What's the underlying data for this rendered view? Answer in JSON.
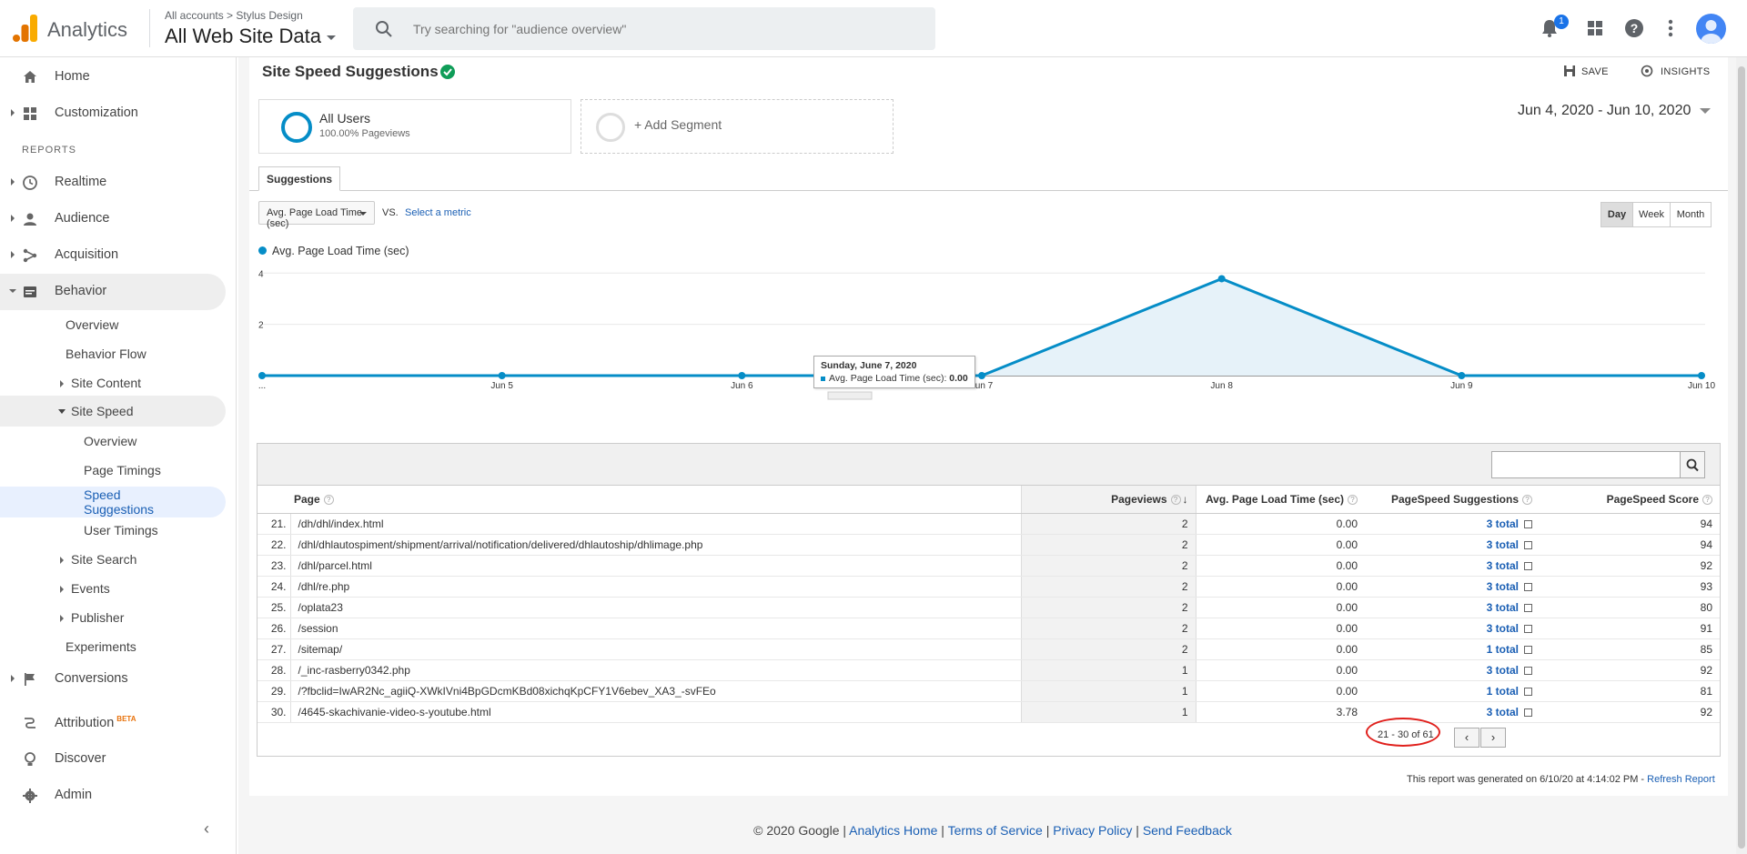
{
  "header": {
    "app_name": "Analytics",
    "breadcrumb": "All accounts > Stylus Design",
    "property": "All Web Site Data",
    "search_placeholder": "Try searching for \"audience overview\"",
    "notifications_count": "1"
  },
  "sidebar": {
    "home": "Home",
    "customization": "Customization",
    "reports_label": "REPORTS",
    "realtime": "Realtime",
    "audience": "Audience",
    "acquisition": "Acquisition",
    "behavior": "Behavior",
    "behavior_sub": {
      "overview": "Overview",
      "behavior_flow": "Behavior Flow",
      "site_content": "Site Content",
      "site_speed": "Site Speed",
      "site_speed_sub": {
        "overview": "Overview",
        "page_timings": "Page Timings",
        "speed_suggestions_1": "Speed",
        "speed_suggestions_2": "Suggestions",
        "user_timings": "User Timings"
      },
      "site_search": "Site Search",
      "events": "Events",
      "publisher": "Publisher",
      "experiments": "Experiments"
    },
    "conversions": "Conversions",
    "attribution": "Attribution",
    "attribution_badge": "BETA",
    "discover": "Discover",
    "admin": "Admin"
  },
  "report": {
    "title": "Site Speed Suggestions",
    "save_label": "SAVE",
    "insights_label": "INSIGHTS",
    "segment_name": "All Users",
    "segment_sub": "100.00% Pageviews",
    "add_segment": "+ Add Segment",
    "date_range": "Jun 4, 2020 - Jun 10, 2020",
    "tab": "Suggestions",
    "metric": "Avg. Page Load Time (sec)",
    "vs": "VS.",
    "select_metric": "Select a metric",
    "periods": [
      "Day",
      "Week",
      "Month"
    ],
    "tooltip_date": "Sunday, June 7, 2020",
    "tooltip_metric": "Avg. Page Load Time (sec):",
    "tooltip_value": "0.00"
  },
  "chart_data": {
    "type": "area",
    "series": [
      {
        "name": "Avg. Page Load Time (sec)",
        "values": [
          0,
          0,
          0,
          0,
          3.78,
          0,
          0
        ]
      }
    ],
    "x": [
      "...",
      "Jun 5",
      "Jun 6",
      "Jun 7",
      "Jun 8",
      "Jun 9",
      "Jun 10"
    ],
    "yticks": [
      "4",
      "2"
    ],
    "ylim": [
      0,
      4.4
    ],
    "color": "#058dc7"
  },
  "table": {
    "headers": {
      "page": "Page",
      "pageviews": "Pageviews",
      "load": "Avg. Page Load Time (sec)",
      "suggestions": "PageSpeed Suggestions",
      "score": "PageSpeed Score"
    },
    "rows": [
      {
        "n": "21.",
        "page": "/dh/dhl/index.html",
        "pv": "2",
        "load": "0.00",
        "sugg": "3 total",
        "score": "94"
      },
      {
        "n": "22.",
        "page": "/dhl/dhlautospiment/shipment/arrival/notification/delivered/dhlautoship/dhlimage.php",
        "pv": "2",
        "load": "0.00",
        "sugg": "3 total",
        "score": "94"
      },
      {
        "n": "23.",
        "page": "/dhl/parcel.html",
        "pv": "2",
        "load": "0.00",
        "sugg": "3 total",
        "score": "92"
      },
      {
        "n": "24.",
        "page": "/dhl/re.php",
        "pv": "2",
        "load": "0.00",
        "sugg": "3 total",
        "score": "93"
      },
      {
        "n": "25.",
        "page": "/oplata23",
        "pv": "2",
        "load": "0.00",
        "sugg": "3 total",
        "score": "80"
      },
      {
        "n": "26.",
        "page": "/session",
        "pv": "2",
        "load": "0.00",
        "sugg": "3 total",
        "score": "91"
      },
      {
        "n": "27.",
        "page": "/sitemap/",
        "pv": "2",
        "load": "0.00",
        "sugg": "1 total",
        "score": "85"
      },
      {
        "n": "28.",
        "page": "/_inc-rasberry0342.php",
        "pv": "1",
        "load": "0.00",
        "sugg": "3 total",
        "score": "92"
      },
      {
        "n": "29.",
        "page": "/?fbclid=IwAR2Nc_agiiQ-XWkIVni4BpGDcmKBd08xichqKpCFY1V6ebev_XA3_-svFEo",
        "pv": "1",
        "load": "0.00",
        "sugg": "1 total",
        "score": "81"
      },
      {
        "n": "30.",
        "page": "/4645-skachivanie-video-s-youtube.html",
        "pv": "1",
        "load": "3.78",
        "sugg": "3 total",
        "score": "92"
      }
    ],
    "pagination": "21 - 30 of 61"
  },
  "generated": "This report was generated on 6/10/20 at 4:14:02 PM - ",
  "refresh": "Refresh Report",
  "footer": {
    "copyright": "© 2020 Google | ",
    "links": [
      "Analytics Home",
      "Terms of Service",
      "Privacy Policy",
      "Send Feedback"
    ],
    "sep": " | "
  }
}
